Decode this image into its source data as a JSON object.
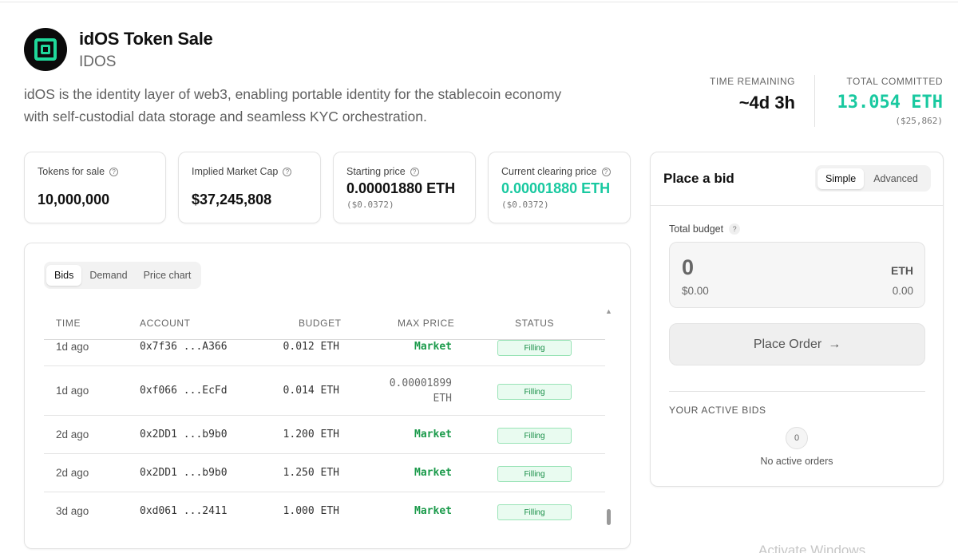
{
  "header": {
    "title": "idOS Token Sale",
    "ticker": "IDOS",
    "description": "idOS is the identity layer of web3, enabling portable identity for the stablecoin economy with self-custodial data storage and seamless KYC orchestration."
  },
  "stats": {
    "time_remaining_label": "TIME REMAINING",
    "time_remaining_value": "~4d 3h",
    "total_committed_label": "TOTAL COMMITTED",
    "total_committed_value": "13.054 ETH",
    "total_committed_usd": "($25,862)"
  },
  "cards": {
    "tokens_for_sale": {
      "label": "Tokens for sale",
      "value": "10,000,000"
    },
    "implied_market_cap": {
      "label": "Implied Market Cap",
      "value": "$37,245,808"
    },
    "starting_price": {
      "label": "Starting price",
      "value": "0.00001880 ETH",
      "usd": "($0.0372)"
    },
    "clearing_price": {
      "label": "Current clearing price",
      "value": "0.00001880 ETH",
      "usd": "($0.0372)"
    }
  },
  "bids_panel": {
    "tabs": [
      "Bids",
      "Demand",
      "Price chart"
    ],
    "active_tab": "Bids",
    "columns": [
      "TIME",
      "ACCOUNT",
      "BUDGET",
      "MAX PRICE",
      "STATUS"
    ],
    "rows": [
      {
        "time": "1d ago",
        "account_start": "0x7f36",
        "account_end": "A366",
        "budget": "0.012 ETH",
        "max_price": "Market",
        "status": "Filling"
      },
      {
        "time": "1d ago",
        "account_start": "0xf066",
        "account_end": "EcFd",
        "budget": "0.014 ETH",
        "max_price_line1": "0.00001899",
        "max_price_line2": "ETH",
        "status": "Filling"
      },
      {
        "time": "2d ago",
        "account_start": "0x2DD1",
        "account_end": "b9b0",
        "budget": "1.200 ETH",
        "max_price": "Market",
        "status": "Filling"
      },
      {
        "time": "2d ago",
        "account_start": "0x2DD1",
        "account_end": "b9b0",
        "budget": "1.250 ETH",
        "max_price": "Market",
        "status": "Filling"
      },
      {
        "time": "3d ago",
        "account_start": "0xd061",
        "account_end": "2411",
        "budget": "1.000 ETH",
        "max_price": "Market",
        "status": "Filling"
      }
    ],
    "ellipsis": "..."
  },
  "bid_form": {
    "title": "Place a bid",
    "modes": [
      "Simple",
      "Advanced"
    ],
    "active_mode": "Simple",
    "budget_label": "Total budget",
    "help_glyph": "?",
    "amount": "0",
    "amount_usd": "$0.00",
    "currency": "ETH",
    "balance": "0.00",
    "place_order_label": "Place Order",
    "arrow": "→",
    "active_bids_label": "YOUR ACTIVE BIDS",
    "active_bids_count": "0",
    "no_orders_text": "No active orders"
  },
  "icons": {
    "logo": "idos-logo-icon",
    "help": "question-circle-icon",
    "arrow": "arrow-right-icon"
  },
  "colors": {
    "accent_green": "#1fd99a",
    "teal_value": "#19c9a0",
    "market_green": "#1a9a4a",
    "badge_bg": "#e9fbf0"
  },
  "watermark": "Activate Windows"
}
